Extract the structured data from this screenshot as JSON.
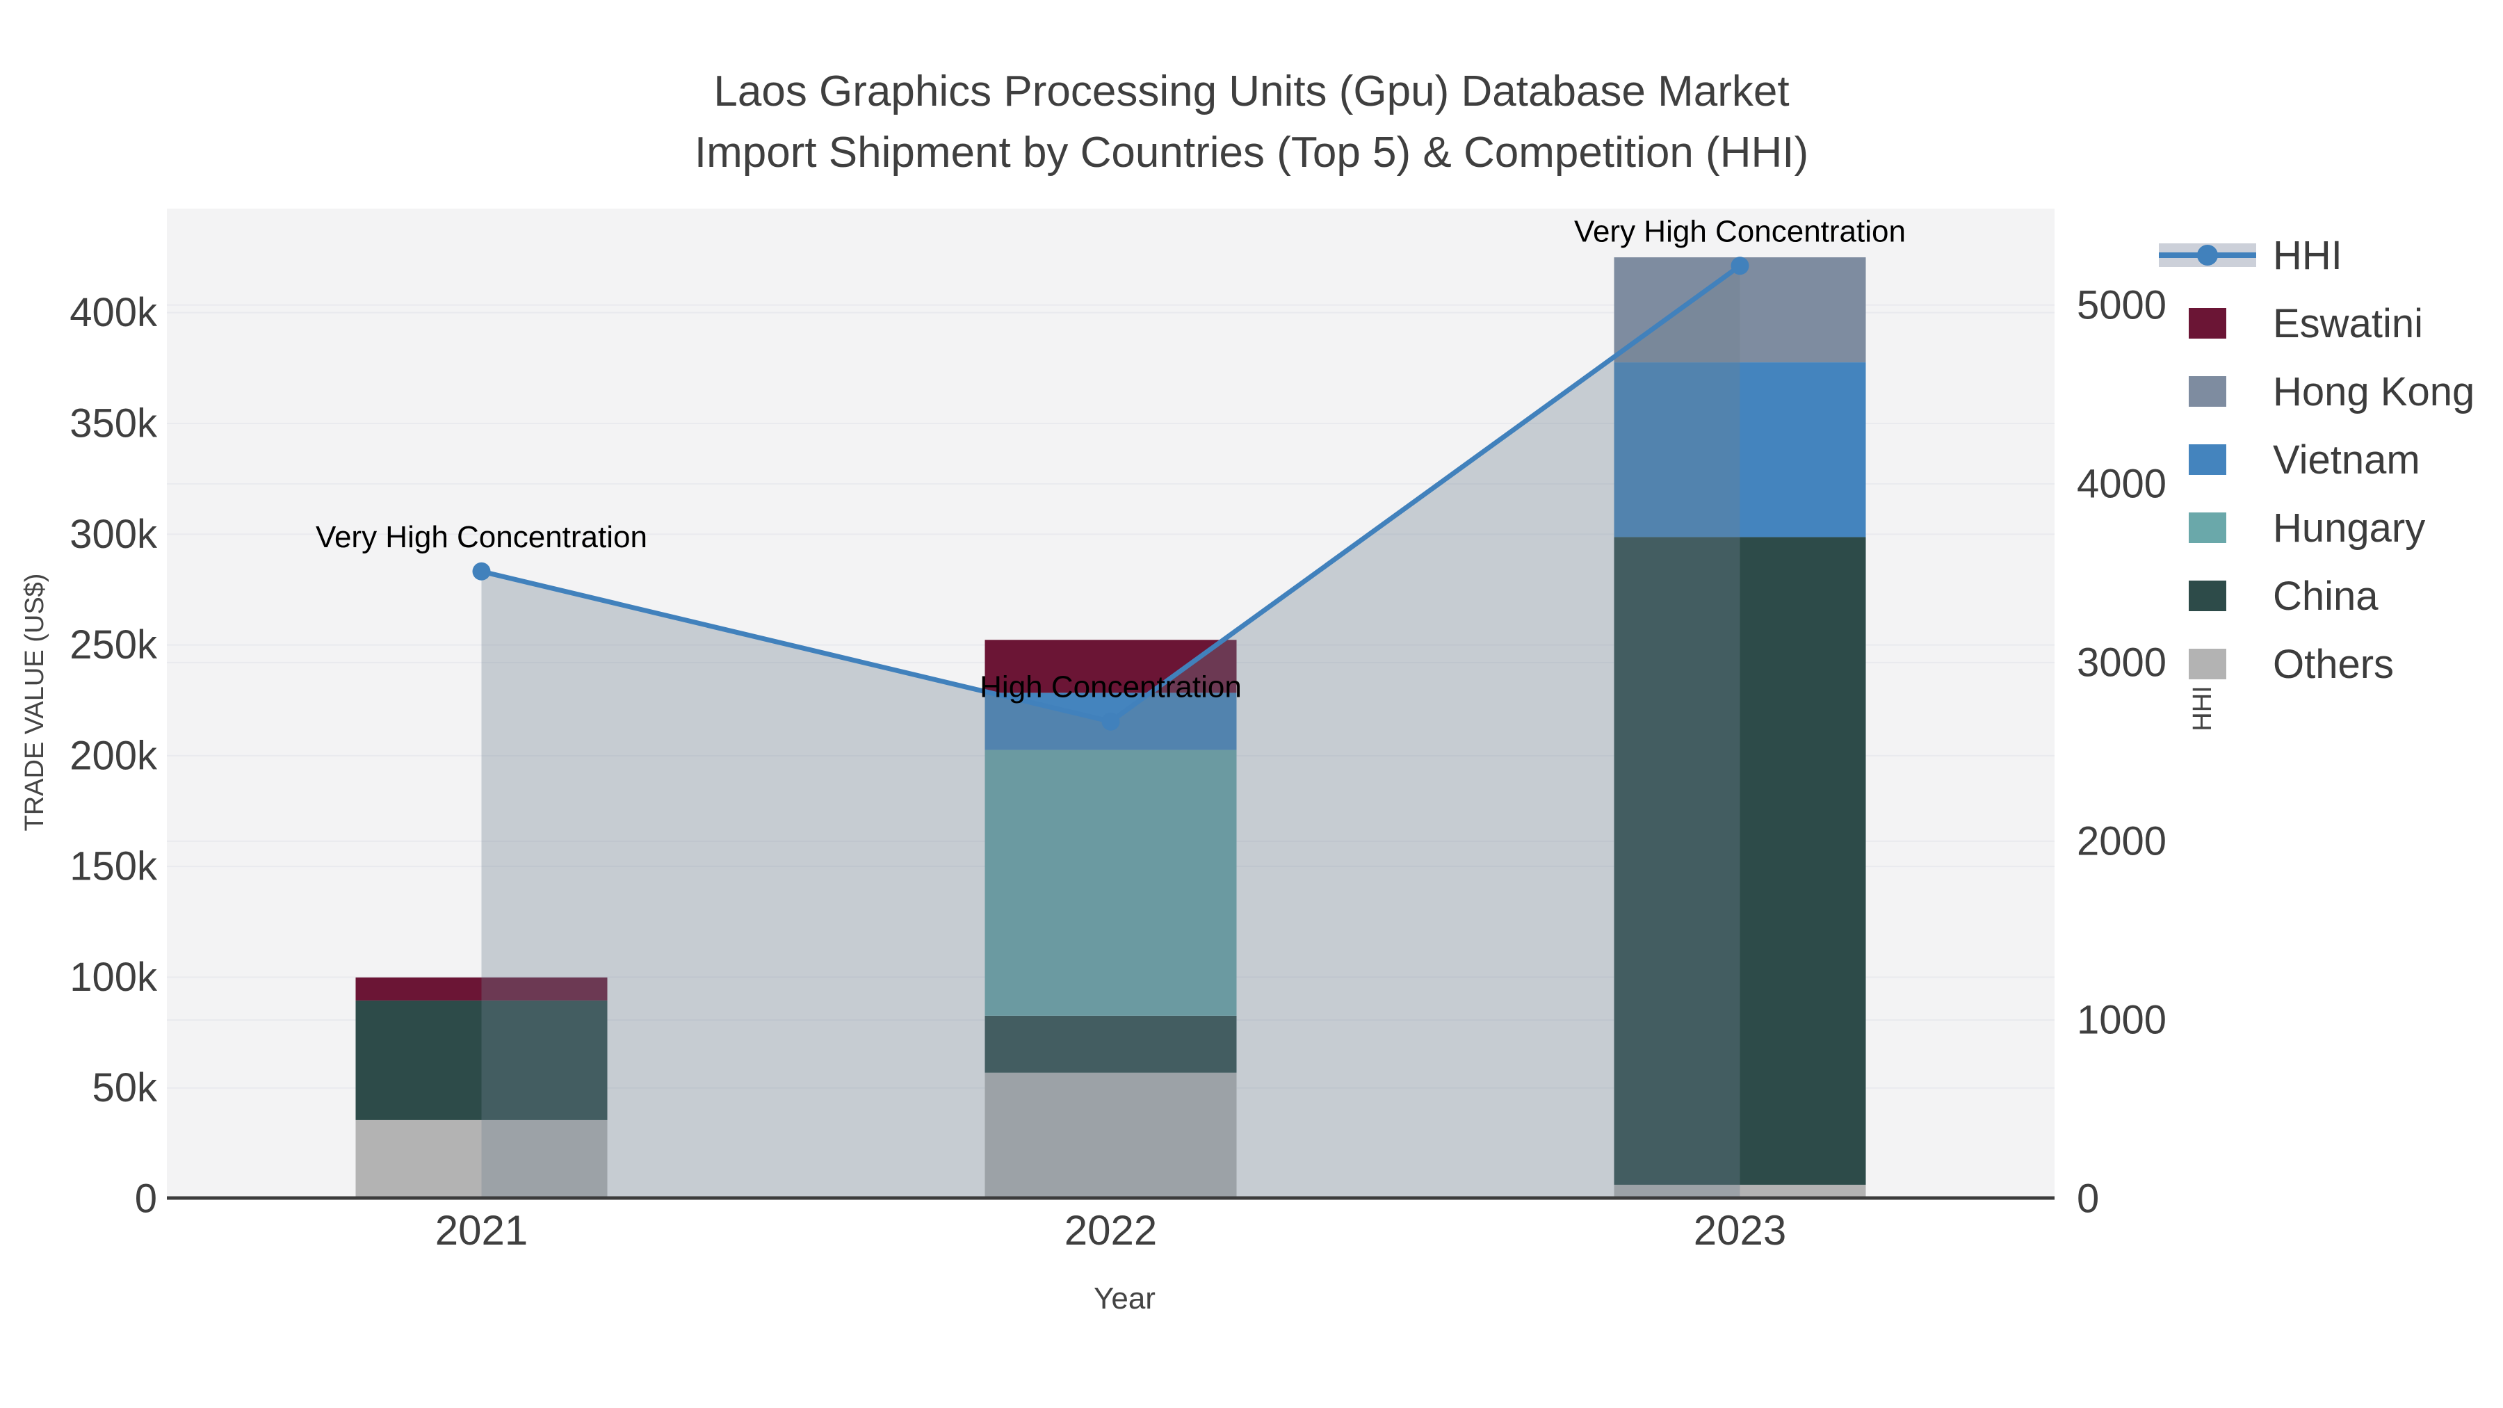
{
  "header": {
    "line1": "Laos Graphics Processing Units (Gpu) Database Market",
    "line2": "Import Shipment by Countries (Top 5) & Competition (HHI)"
  },
  "legend": {
    "items": [
      {
        "label": "HHI",
        "color": "#4181bc",
        "type": "line"
      },
      {
        "label": "Eswatini",
        "color": "#6b1535",
        "type": "bar"
      },
      {
        "label": "Hong Kong",
        "color": "#7e8ca0",
        "type": "bar"
      },
      {
        "label": "Vietnam",
        "color": "#4484be",
        "type": "bar"
      },
      {
        "label": "Hungary",
        "color": "#6aa8aa",
        "type": "bar"
      },
      {
        "label": "China",
        "color": "#2d4b49",
        "type": "bar"
      },
      {
        "label": "Others",
        "color": "#b3b3b3",
        "type": "bar"
      }
    ]
  },
  "colors": {
    "plot_bg": "#f3f3f4",
    "gridline": "#e9eaee",
    "axis_line": "#3c3c3c",
    "tick_text": "#3f3f3f",
    "annotation_text": "#000000",
    "hhi_line": "#4181bc",
    "hhi_area_fill": "rgba(112,128,144,0.34)"
  },
  "chart_data": {
    "type": "combo",
    "categories": [
      "2021",
      "2022",
      "2023"
    ],
    "stack_order": [
      "Others",
      "China",
      "Hungary",
      "Vietnam",
      "Hong Kong",
      "Eswatini"
    ],
    "bar_series": [
      {
        "name": "Eswatini",
        "color": "#6b1535",
        "values": [
          10400,
          23900,
          0
        ]
      },
      {
        "name": "Hong Kong",
        "color": "#7e8ca0",
        "values": [
          0,
          0,
          47400
        ]
      },
      {
        "name": "Vietnam",
        "color": "#4484be",
        "values": [
          0,
          25800,
          78900
        ]
      },
      {
        "name": "Hungary",
        "color": "#6aa8aa",
        "values": [
          0,
          120000,
          0
        ]
      },
      {
        "name": "China",
        "color": "#2d4b49",
        "values": [
          54000,
          25700,
          292400
        ]
      },
      {
        "name": "Others",
        "color": "#b3b3b3",
        "values": [
          35500,
          56900,
          6300
        ]
      }
    ],
    "line_series": {
      "name": "HHI",
      "axis": "right",
      "color": "#4181bc",
      "values": [
        3510,
        2670,
        5220
      ],
      "area": true
    },
    "axes": {
      "x": {
        "title": "Year",
        "tick_labels": [
          "2021",
          "2022",
          "2023"
        ]
      },
      "y_left": {
        "title": "TRADE VALUE (US$)",
        "tick_labels": [
          "0",
          "50k",
          "100k",
          "150k",
          "200k",
          "250k",
          "300k",
          "350k",
          "400k"
        ],
        "tick_values": [
          0,
          50000,
          100000,
          150000,
          200000,
          250000,
          300000,
          350000,
          400000
        ],
        "range": [
          0,
          447000
        ],
        "grid": true
      },
      "y_right": {
        "title": "HHI",
        "tick_labels": [
          "0",
          "1000",
          "2000",
          "3000",
          "4000",
          "5000"
        ],
        "tick_values": [
          0,
          1000,
          2000,
          3000,
          4000,
          5000
        ],
        "range": [
          0,
          5540
        ],
        "grid": true
      }
    },
    "annotations": [
      {
        "text": "Very High Concentration",
        "category": "2021"
      },
      {
        "text": "High Concentration",
        "category": "2022"
      },
      {
        "text": "Very High Concentration",
        "category": "2023"
      }
    ],
    "legend_position": "right"
  }
}
